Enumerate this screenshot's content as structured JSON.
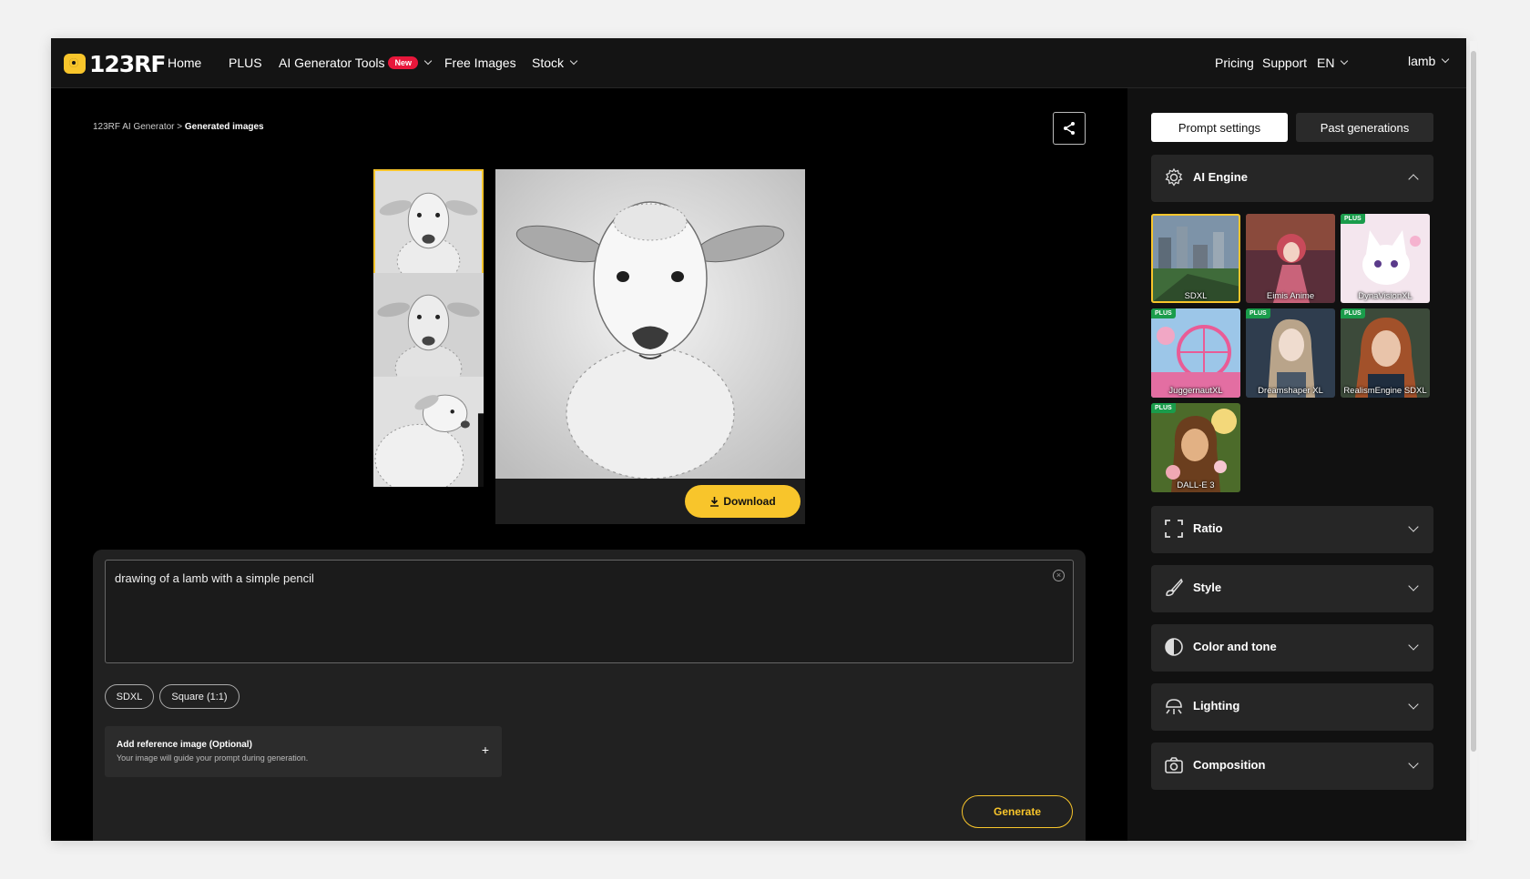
{
  "nav": {
    "logo": "123RF",
    "items": [
      "Home",
      "PLUS",
      "AI Generator Tools",
      "Free Images",
      "Stock"
    ],
    "new_badge": "New",
    "right_items": [
      "Pricing",
      "Support",
      "EN"
    ],
    "user": "lamb"
  },
  "breadcrumb": {
    "parent": "123RF AI Generator",
    "separator": ">",
    "current": "Generated images"
  },
  "preview": {
    "download_label": "Download"
  },
  "prompt": {
    "text": "drawing of a lamb with a simple pencil",
    "chips": [
      "SDXL",
      "Square (1:1)"
    ],
    "reference_title": "Add reference image (Optional)",
    "reference_subtitle": "Your image will guide your prompt during generation.",
    "reference_plus": "+",
    "generate_label": "Generate"
  },
  "sidebar": {
    "tabs": [
      "Prompt settings",
      "Past generations"
    ],
    "engine_title": "AI Engine",
    "plus_badge": "PLUS",
    "engines": [
      {
        "name": "SDXL",
        "plus": false,
        "selected": true
      },
      {
        "name": "Eimis Anime",
        "plus": false,
        "selected": false
      },
      {
        "name": "DynaVisionXL",
        "plus": true,
        "selected": false
      },
      {
        "name": "JuggernautXL",
        "plus": true,
        "selected": false
      },
      {
        "name": "Dreamshaper XL",
        "plus": true,
        "selected": false
      },
      {
        "name": "RealismEngine SDXL",
        "plus": true,
        "selected": false
      },
      {
        "name": "DALL-E 3",
        "plus": true,
        "selected": false
      }
    ],
    "sections": [
      "Ratio",
      "Style",
      "Color and tone",
      "Lighting",
      "Composition"
    ]
  },
  "colors": {
    "accent": "#f8c52b",
    "plus_green": "#1a9c4b",
    "new_red": "#e8173b"
  }
}
